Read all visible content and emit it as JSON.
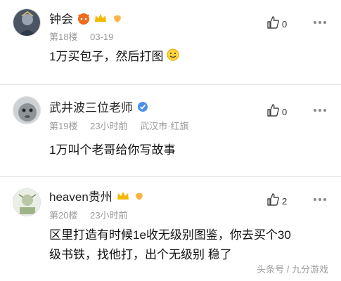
{
  "comments": [
    {
      "user": "钟会",
      "floor": "第18楼",
      "time": "03-19",
      "location": "",
      "likes": "0",
      "text_lines": [
        "1万买包子，然后打图"
      ]
    },
    {
      "user": "武井波三位老师",
      "floor": "第19楼",
      "time": "23小时前",
      "location": "武汉市·红旗",
      "likes": "0",
      "text_lines": [
        "1万叫个老哥给你写故事"
      ]
    },
    {
      "user": "heaven贵州",
      "floor": "第20楼",
      "time": "23小时前",
      "location": "",
      "likes": "2",
      "text_lines": [
        "区里打造有时候1e收无级别图鉴，你去买个30",
        "级书铁，找他打，出个无级别 稳了"
      ]
    }
  ],
  "watermark": "头条号 / 九分游戏",
  "colors": {
    "badge_gold": "#f5b800",
    "badge_blue": "#4a8fe8",
    "devil_red": "#f06a1e",
    "meta_gray": "#9a9a9a"
  },
  "icons": [
    "like-icon",
    "more-icon",
    "crown-badge-icon",
    "devil-badge-icon",
    "leaf-badge-icon",
    "verified-badge-icon",
    "smile-emoji-icon"
  ]
}
